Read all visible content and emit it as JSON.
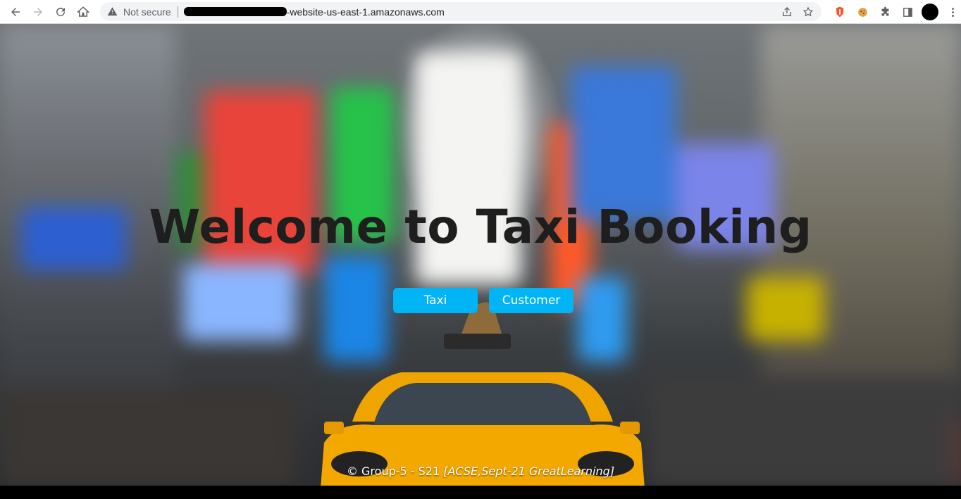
{
  "browser": {
    "security_label": "Not secure",
    "url_visible": "-website-us-east-1.amazonaws.com"
  },
  "page": {
    "title": "Welcome to Taxi Booking",
    "buttons": {
      "taxi": "Taxi",
      "customer": "Customer"
    },
    "footer": {
      "prefix": "© Group-5 - S21 ",
      "italic": "[ACSE,Sept-21 GreatLearning]"
    }
  },
  "colors": {
    "button_bg": "#00b4f5",
    "title": "#1e1e1e",
    "taxi_yellow": "#f5a300"
  },
  "icons": [
    "back-icon",
    "forward-icon",
    "reload-icon",
    "home-icon",
    "warning-icon",
    "share-icon",
    "star-icon",
    "brave-icon",
    "cookie-extension-icon",
    "puzzle-extensions-icon",
    "side-panel-icon",
    "avatar",
    "menu-dots-icon"
  ]
}
